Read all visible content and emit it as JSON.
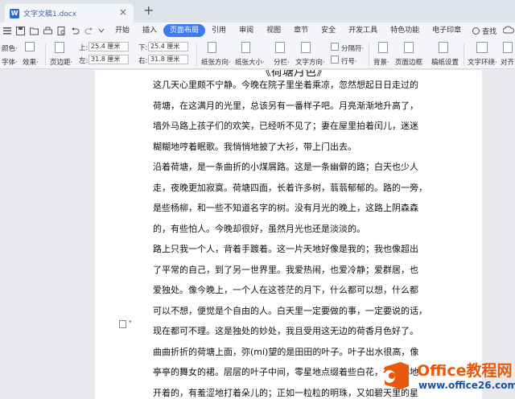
{
  "window": {
    "doc_tab_title": "文字文稿1.docx",
    "doc_icon_letter": "W",
    "close_glyph": "×",
    "new_tab_glyph": "+"
  },
  "menu": {
    "items": [
      "开始",
      "插入",
      "页面布局",
      "引用",
      "审阅",
      "视图",
      "章节",
      "安全",
      "开发工具",
      "特色功能",
      "电子印章"
    ],
    "active": "页面布局",
    "search_label": "查找"
  },
  "ribbon": {
    "color_label": "颜色·",
    "font_label": "字体·",
    "effect_label": "效果·",
    "margin_label": "页边距·",
    "top_label": "上:",
    "top_value": "25.4 厘米",
    "bottom_label": "下:",
    "bottom_value": "25.4 厘米",
    "left_label": "左:",
    "left_value": "31.8 厘米",
    "right_label": "右:",
    "right_value": "31.8 厘米",
    "orientation_label": "纸张方向·",
    "size_label": "纸张大小·",
    "columns_label": "分栏·",
    "text_direction_label": "文字方向·",
    "separator_label": "分隔符·",
    "line_number_label": "行号·",
    "background_label": "背景·",
    "page_border_label": "页面边框",
    "paper_setting_label": "稿纸设置",
    "text_wrap_label": "文字环绕·",
    "align_label": "对齐"
  },
  "document": {
    "heading_fragment": "《荷塘月色》",
    "lines": [
      "这几天心里颇不宁静。今晚在院子里坐着乘凉，忽然想起日日走过的",
      "荷塘，在这满月的光里，总该另有一番样子吧。月亮渐渐地升高了，",
      "墙外马路上孩子们的欢笑，已经听不见了；妻在屋里拍着闰儿，迷迷",
      "糊糊地哼着眠歌。我悄悄地披了大衫，带上门出去。",
      "沿着荷塘，是一条曲折的小煤屑路。这是一条幽僻的路；白天也少人",
      "走，夜晚更加寂寞。荷塘四面，长着许多树，蓊蓊郁郁的。路的一旁，",
      "是些杨柳，和一些不知道名字的树。没有月光的晚上，这路上阴森森",
      "的，有些怕人。今晚却很好，虽然月光也还是淡淡的。",
      "路上只我一个人，背着手踱着。这一片天地好像是我的；我也像超出",
      "了平常的自己，到了另一世界里。我爱热闹，也爱冷静；爱群居，也",
      "爱独处。像今晚上，一个人在这苍茫的月下，什么都可以想，什么都",
      "可以不想，便觉是个自由的人。白天里一定要做的事，一定要说的话，",
      "现在都可不理。这是独处的妙处，我且受用这无边的荷香月色好了。",
      "曲曲折折的荷塘上面，弥(mí)望的是田田的叶子。叶子出水很高，像",
      "亭亭的舞女的裙。层层的叶子中间，零星地点缀着些白花，有袅娜地",
      "开着的，有羞涩地打着朵儿的；正如一粒粒的明珠，又如碧天里的星"
    ]
  },
  "watermark": {
    "brand": "Office教程网",
    "url": "www.office26.com"
  },
  "colors": {
    "accent": "#3d7cf0",
    "brand_orange": "#e8590c",
    "brand_blue": "#1d4f9c"
  }
}
